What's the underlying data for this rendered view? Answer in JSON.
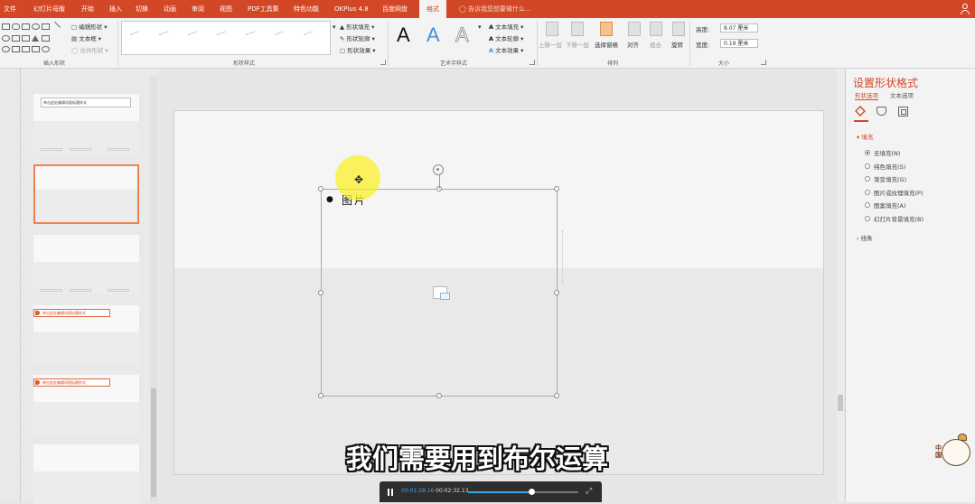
{
  "app": {
    "tabs": [
      "文件",
      "幻灯片母版",
      "开始",
      "插入",
      "切换",
      "动画",
      "审阅",
      "视图",
      "PDF工具集",
      "特色功能",
      "OKPlus 4.8",
      "百度网盘",
      "格式"
    ],
    "active_tab": "格式",
    "tell_me": "告诉我您想要做什么..."
  },
  "ribbon": {
    "insert_shapes": {
      "edit_shape": "编辑形状",
      "text_box": "文本框",
      "merge_shapes": "合并形状",
      "label": "插入形状"
    },
    "shape_styles": {
      "fill": "形状填充",
      "outline": "形状轮廓",
      "effects": "形状效果",
      "label": "形状样式"
    },
    "wordart": {
      "fill": "文本填充",
      "outline": "文本轮廓",
      "effects": "文本效果",
      "label": "艺术字样式",
      "letter": "A"
    },
    "arrange": {
      "forward": "上移一层",
      "backward": "下移一层",
      "selection_pane": "选择窗格",
      "align": "对齐",
      "group": "组合",
      "rotate": "旋转",
      "label": "排列"
    },
    "size": {
      "height_label": "高度:",
      "height_value": "8.07 厘米",
      "width_label": "宽度:",
      "width_value": "0.19 厘米",
      "label": "大小"
    }
  },
  "thumbnails": {
    "t1_title": "单击此处编辑母版标题样式",
    "t4_title": "单击此处编辑母版标题样式",
    "t5_title": "单击此处编辑母版标题样式"
  },
  "slide": {
    "placeholder_text": "图片",
    "subtitle": "我们需要用到布尔运算"
  },
  "player": {
    "current_time": "00:01:28.16",
    "total_time": "00:02:32.13",
    "progress_fraction": 0.57
  },
  "format_pane": {
    "title": "设置形状格式",
    "tab_shape": "形状选项",
    "tab_text": "文本选项",
    "fill_section": "填充",
    "fill_options": [
      "无填充(N)",
      "纯色填充(S)",
      "渐变填充(G)",
      "图片或纹理填充(P)",
      "图案填充(A)",
      "幻灯片背景填充(B)"
    ],
    "selected_fill": 0,
    "line_section": "线条"
  },
  "mascot": {
    "text": "中国"
  },
  "colors": {
    "accent": "#d24726",
    "selection_border": "#f0824c",
    "progress": "#3ba7e8"
  }
}
